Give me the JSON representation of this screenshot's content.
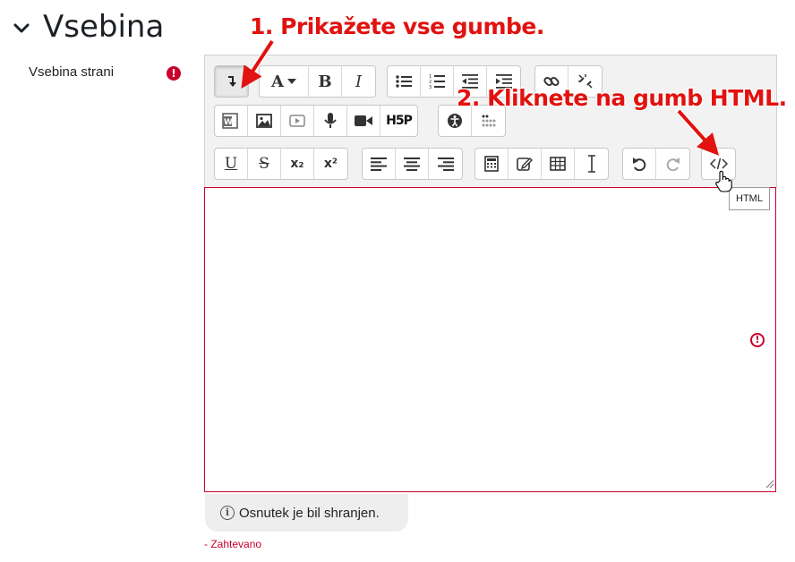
{
  "section": {
    "title": "Vsebina",
    "collapse_icon": "chevron-down-icon"
  },
  "field": {
    "label": "Vsebina strani",
    "required_icon": "exclamation-circle-icon"
  },
  "toolbar": {
    "rows": [
      [
        [
          "show-more-buttons-icon",
          "font-size-dropdown-icon",
          "bold-icon",
          "italic-icon"
        ],
        [
          "unordered-list-icon",
          "ordered-list-icon",
          "outdent-icon",
          "indent-icon"
        ],
        [
          "link-icon",
          "unlink-icon"
        ]
      ],
      [
        [
          "word-import-icon",
          "image-icon",
          "media-icon",
          "record-audio-icon",
          "record-video-icon",
          "h5p-icon"
        ],
        [
          "accessibility-checker-icon",
          "screenreader-helper-icon"
        ]
      ],
      [
        [
          "underline-icon",
          "strikethrough-icon",
          "subscript-icon",
          "superscript-icon"
        ],
        [
          "align-left-icon",
          "align-center-icon",
          "align-right-icon"
        ],
        [
          "equation-editor-icon",
          "manage-files-icon",
          "table-icon",
          "character-map-icon"
        ],
        [
          "undo-icon",
          "redo-icon"
        ],
        [
          "html-source-icon"
        ]
      ]
    ],
    "font_letter": "A",
    "bold_letter": "B",
    "italic_letter": "I",
    "underline_letter": "U",
    "strike_letter": "S",
    "subscript_text": "x₂",
    "superscript_text": "x²",
    "h5p_text": "H5P",
    "word_badge": "W"
  },
  "tooltip": {
    "text": "HTML"
  },
  "editor": {
    "content": "",
    "error_icon": "exclamation-circle-icon"
  },
  "draft_notice": {
    "icon": "info-icon",
    "text": "Osnutek je bil shranjen."
  },
  "required_note": "- Zahtevano",
  "annotations": {
    "step1": "1. Prikažete vse gumbe.",
    "step2": "2. Kliknete na gumb HTML."
  },
  "colors": {
    "required_red": "#c9002b",
    "annotation_red": "#e1120f",
    "toolbar_bg": "#f2f2f2"
  }
}
